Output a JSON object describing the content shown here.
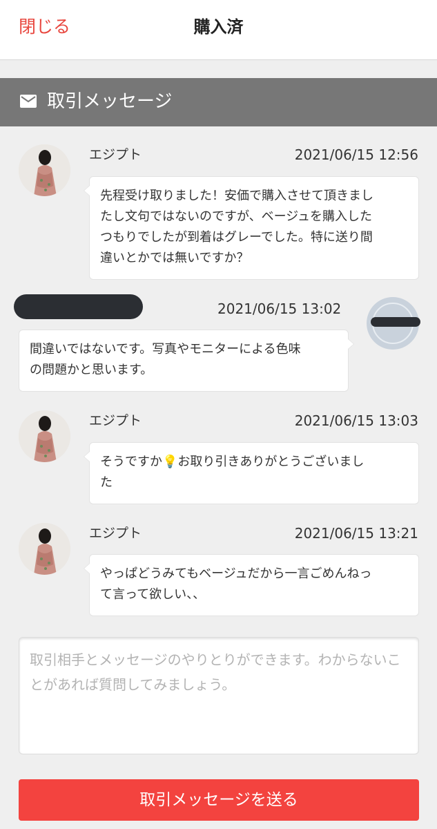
{
  "header": {
    "close_label": "閉じる",
    "title": "購入済"
  },
  "section": {
    "icon": "mail-icon",
    "label": "取引メッセージ"
  },
  "messages": [
    {
      "side": "left",
      "name": "エジプト",
      "time": "2021/06/15 12:56",
      "text": "先程受け取りました！安価で購入させて頂きまし\nたし文句ではないのですが、ベージュを購入した\nつもりでしたが到着はグレーでした。特に送り間\n違いとかでは無いですか？"
    },
    {
      "side": "right",
      "name": "",
      "time": "2021/06/15 13:02",
      "text": "間違いではないです。写真やモニターによる色味\nの問題かと思います。"
    },
    {
      "side": "left",
      "name": "エジプト",
      "time": "2021/06/15 13:03",
      "text": "そうですか💡お取り引きありがとうございまし\nた"
    },
    {
      "side": "left",
      "name": "エジプト",
      "time": "2021/06/15 13:21",
      "text": "やっぱどうみてもベージュだから一言ごめんねっ\nて言って欲しい、、"
    }
  ],
  "composer": {
    "placeholder": "取引相手とメッセージのやりとりができます。わからないことがあれば質問してみましょう。",
    "send_label": "取引メッセージを送る"
  },
  "colors": {
    "accent": "#f3433f",
    "close_text": "#e8473f",
    "section_bar": "#777777",
    "background": "#efefef"
  }
}
